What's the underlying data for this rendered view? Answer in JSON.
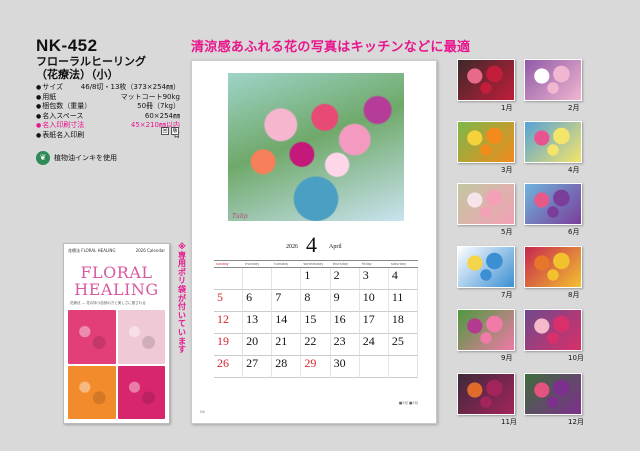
{
  "product": {
    "code": "NK-452",
    "name_line1": "フローラルヒーリング",
    "name_line2": "（花療法）（小）"
  },
  "specs": [
    {
      "k": "サイズ",
      "v": "46/8切・13枚（373×254㎜）",
      "pink": false
    },
    {
      "k": "用紙",
      "v": "マットコート90kg",
      "pink": false
    },
    {
      "k": "梱包数（重量）",
      "v": "50冊（7kg）",
      "pink": false
    },
    {
      "k": "名入スペース",
      "v": "60×254㎜",
      "pink": false
    },
    {
      "k": "名入印刷寸法",
      "v": "45×210㎜以内",
      "pink": true
    },
    {
      "k": "表紙名入印刷",
      "v": "有",
      "pink": false
    }
  ],
  "badges": [
    "回",
    "版"
  ],
  "eco": {
    "icon": "leaf-icon",
    "text": "植物油インキを使用"
  },
  "cover": {
    "header_left": "花療法 FLORAL HEALING",
    "header_mid": "2026 Calendar",
    "title_line1": "FLORAL",
    "title_line2": "HEALING",
    "subtitle": "花療法 — 花の持つ自然の力と美しさに癒される",
    "colors": [
      "#e23f7a",
      "#f0c9d6",
      "#f28b2c",
      "#d8266d"
    ]
  },
  "side_note": "※専用ポリ袋が付いています",
  "banner": "清涼感あふれる花の写真はキッチンなどに最適",
  "sheet": {
    "photo_caption": "Tulip",
    "year": "2026",
    "month_num": "4",
    "month_name": "April",
    "weekdays": [
      "sunday",
      "monday",
      "tuesday",
      "wednesday",
      "thursday",
      "friday",
      "saturday"
    ],
    "weeks": [
      [
        {
          "d": ""
        },
        {
          "d": ""
        },
        {
          "d": ""
        },
        {
          "d": "1"
        },
        {
          "d": "2"
        },
        {
          "d": "3"
        },
        {
          "d": "4"
        }
      ],
      [
        {
          "d": "5",
          "sun": true
        },
        {
          "d": "6"
        },
        {
          "d": "7"
        },
        {
          "d": "8"
        },
        {
          "d": "9"
        },
        {
          "d": "10"
        },
        {
          "d": "11"
        }
      ],
      [
        {
          "d": "12",
          "sun": true
        },
        {
          "d": "13"
        },
        {
          "d": "14"
        },
        {
          "d": "15"
        },
        {
          "d": "16"
        },
        {
          "d": "17"
        },
        {
          "d": "18"
        }
      ],
      [
        {
          "d": "19",
          "sun": true
        },
        {
          "d": "20"
        },
        {
          "d": "21"
        },
        {
          "d": "22"
        },
        {
          "d": "23"
        },
        {
          "d": "24"
        },
        {
          "d": "25"
        }
      ],
      [
        {
          "d": "26",
          "sun": true
        },
        {
          "d": "27"
        },
        {
          "d": "28"
        },
        {
          "d": "29",
          "hol": true
        },
        {
          "d": "30"
        },
        {
          "d": ""
        },
        {
          "d": ""
        }
      ]
    ],
    "footer": "■3月 ■5月",
    "mark": "NK"
  },
  "thumbnails": [
    {
      "label": "1月",
      "c1": "#c21d3a",
      "c2": "#e86a8a",
      "c3": "#3b2a2a"
    },
    {
      "label": "2月",
      "c1": "#f1b6d0",
      "c2": "#ffffff",
      "c3": "#8e5aa8"
    },
    {
      "label": "3月",
      "c1": "#f28a1c",
      "c2": "#f5d23a",
      "c3": "#7cb84a"
    },
    {
      "label": "4月",
      "c1": "#f3e46a",
      "c2": "#e8548f",
      "c3": "#56a2d6"
    },
    {
      "label": "5月",
      "c1": "#f4a0b6",
      "c2": "#f7e4ea",
      "c3": "#c0c8a0"
    },
    {
      "label": "6月",
      "c1": "#7a3d9a",
      "c2": "#e55a88",
      "c3": "#6fb4dd"
    },
    {
      "label": "7月",
      "c1": "#3c8fd3",
      "c2": "#f4d54a",
      "c3": "#ffffff"
    },
    {
      "label": "8月",
      "c1": "#f2c12e",
      "c2": "#e8762a",
      "c3": "#c7264f"
    },
    {
      "label": "9月",
      "c1": "#f07aa8",
      "c2": "#b33a8e",
      "c3": "#4b9a3d"
    },
    {
      "label": "10月",
      "c1": "#d92f6a",
      "c2": "#f5b9cc",
      "c3": "#6d4a8c"
    },
    {
      "label": "11月",
      "c1": "#a3245a",
      "c2": "#e06b2a",
      "c3": "#3c2a3a"
    },
    {
      "label": "12月",
      "c1": "#7d2f8e",
      "c2": "#e4527f",
      "c3": "#3e6c3a"
    }
  ]
}
